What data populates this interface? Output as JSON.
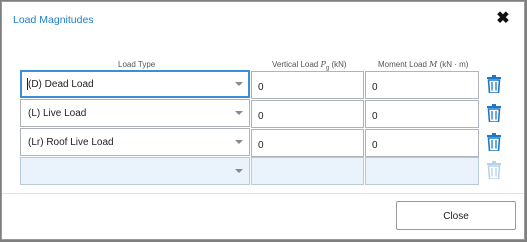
{
  "dialog": {
    "title": "Load Magnitudes",
    "close_icon": "close-icon",
    "close_button_label": "Close"
  },
  "table": {
    "headers": {
      "load_type": "Load Type",
      "vertical_load_prefix": "Vertical Load ",
      "vertical_load_symbol": "P",
      "vertical_load_sub": "g",
      "vertical_load_unit": " (kN)",
      "moment_load_prefix": "Moment Load ",
      "moment_load_symbol": "M",
      "moment_load_unit": " (kN · m)"
    },
    "rows": [
      {
        "load_type": "(D) Dead Load",
        "vertical": "0",
        "moment": "0"
      },
      {
        "load_type": "(L) Live Load",
        "vertical": "0",
        "moment": "0"
      },
      {
        "load_type": "(Lr) Roof Live Load",
        "vertical": "0",
        "moment": "0"
      },
      {
        "load_type": "",
        "vertical": "",
        "moment": ""
      }
    ]
  },
  "colors": {
    "title": "#1f7fcf",
    "trash_active": "#1e78c8",
    "trash_disabled": "#b7d3ec",
    "empty_row_bg": "#eaf3fc"
  }
}
